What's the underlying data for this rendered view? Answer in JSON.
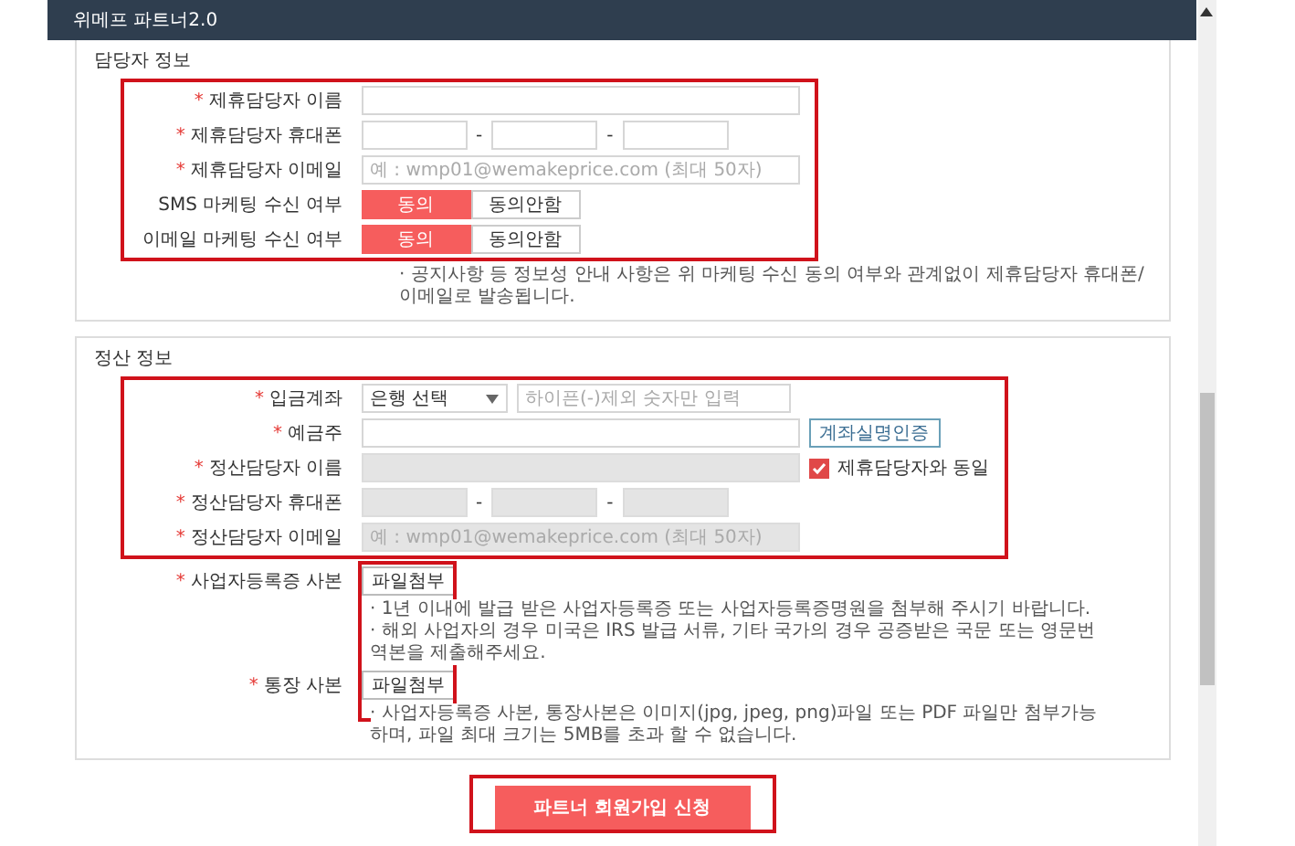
{
  "window": {
    "title": "위메프 파트너2.0"
  },
  "contact_section": {
    "title": "담당자 정보",
    "fields": [
      {
        "kind": "text",
        "label": "제휴담당자 이름",
        "required_mark": "*"
      },
      {
        "kind": "phone",
        "label": "제휴담당자 휴대폰",
        "required_mark": "*",
        "separator": "-"
      },
      {
        "kind": "text",
        "label": "제휴담당자 이메일",
        "required_mark": "*",
        "placeholder": "예 : wmp01@wemakeprice.com (최대 50자)"
      },
      {
        "kind": "toggle",
        "label": "SMS 마케팅 수신 여부",
        "options": [
          {
            "label": "동의",
            "selected": true
          },
          {
            "label": "동의안함",
            "selected": false
          }
        ]
      },
      {
        "kind": "toggle",
        "label": "이메일 마케팅 수신 여부",
        "options": [
          {
            "label": "동의",
            "selected": true
          },
          {
            "label": "동의안함",
            "selected": false
          }
        ]
      }
    ],
    "notes": [
      "· 공지사항 등 정보성 안내 사항은 위 마케팅 수신 동의 여부와 관계없이 제휴담당자 휴대폰/이메일로 발송됩니다."
    ]
  },
  "settlement_section": {
    "title": "정산 정보",
    "fields": [
      {
        "kind": "account",
        "label": "입금계좌",
        "required_mark": "*",
        "select": "은행 선택",
        "placeholder": "하이픈(-)제외 숫자만 입력"
      },
      {
        "kind": "text",
        "label": "예금주",
        "required_mark": "*",
        "disabled": false,
        "button": "계좌실명인증"
      },
      {
        "kind": "text",
        "label": "정산담당자 이름",
        "required_mark": "*",
        "disabled": true,
        "checkbox": {
          "label": "제휴담당자와 동일",
          "checked": true
        }
      },
      {
        "kind": "phone",
        "label": "정산담당자 휴대폰",
        "required_mark": "*",
        "disabled": true,
        "separator": "-"
      },
      {
        "kind": "text",
        "label": "정산담당자 이메일",
        "required_mark": "*",
        "disabled": true,
        "placeholder": "예 : wmp01@wemakeprice.com (최대 50자)"
      }
    ],
    "files": [
      {
        "label": "사업자등록증 사본",
        "required_mark": "*",
        "button": "파일첨부",
        "notes": [
          "· 1년 이내에 발급 받은 사업자등록증 또는 사업자등록증명원을 첨부해 주시기 바랍니다.",
          "· 해외 사업자의 경우 미국은 IRS 발급 서류, 기타 국가의 경우 공증받은 국문 또는 영문번역본을 제출해주세요."
        ]
      },
      {
        "label": "통장 사본",
        "required_mark": "*",
        "button": "파일첨부",
        "notes": [
          "· 사업자등록증 사본, 통장사본은 이미지(jpg, jpeg, png)파일 또는 PDF 파일만 첨부가능하며, 파일 최대 크기는 5MB를 초과 할 수 없습니다."
        ]
      }
    ]
  },
  "submit_button": "파트너 회원가입 신청"
}
